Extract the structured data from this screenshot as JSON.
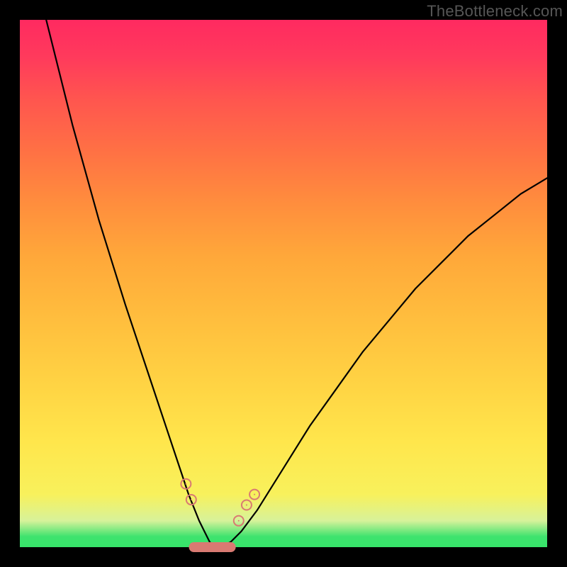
{
  "watermark": "TheBottleneck.com",
  "colors": {
    "frame": "#000000",
    "curve": "#000000",
    "markers": "#d97a72",
    "gradient_top": "#ff2a60",
    "gradient_bottom": "#37e46a"
  },
  "chart_data": {
    "type": "line",
    "title": "",
    "xlabel": "",
    "ylabel": "",
    "xlim": [
      0,
      100
    ],
    "ylim": [
      0,
      100
    ],
    "grid": false,
    "legend": false,
    "series": [
      {
        "name": "bottleneck-curve",
        "x": [
          5,
          10,
          15,
          20,
          25,
          28,
          30,
          32,
          34,
          35,
          36,
          37,
          38,
          40,
          42,
          45,
          50,
          55,
          60,
          65,
          70,
          75,
          80,
          85,
          90,
          95,
          100
        ],
        "values": [
          100,
          80,
          62,
          46,
          31,
          22,
          16,
          10,
          5,
          3,
          1,
          0,
          0,
          1,
          3,
          7,
          15,
          23,
          30,
          37,
          43,
          49,
          54,
          59,
          63,
          67,
          70
        ]
      }
    ],
    "annotations": [
      {
        "name": "marker-bottom-flat",
        "x_range": [
          33,
          40
        ],
        "y": 0
      },
      {
        "name": "marker-left-a",
        "x": 31.5,
        "y": 12
      },
      {
        "name": "marker-left-b",
        "x": 32.5,
        "y": 9
      },
      {
        "name": "marker-right-a",
        "x": 41.5,
        "y": 5
      },
      {
        "name": "marker-right-b",
        "x": 43.0,
        "y": 8
      },
      {
        "name": "marker-right-c",
        "x": 44.5,
        "y": 10
      }
    ],
    "background_gradient": {
      "direction": "vertical",
      "stops": [
        {
          "pos": 0.0,
          "color": "#37e46a"
        },
        {
          "pos": 0.05,
          "color": "#d7f29a"
        },
        {
          "pos": 0.2,
          "color": "#ffe64c"
        },
        {
          "pos": 0.55,
          "color": "#ffa83a"
        },
        {
          "pos": 0.85,
          "color": "#ff554f"
        },
        {
          "pos": 1.0,
          "color": "#ff2a60"
        }
      ]
    }
  }
}
